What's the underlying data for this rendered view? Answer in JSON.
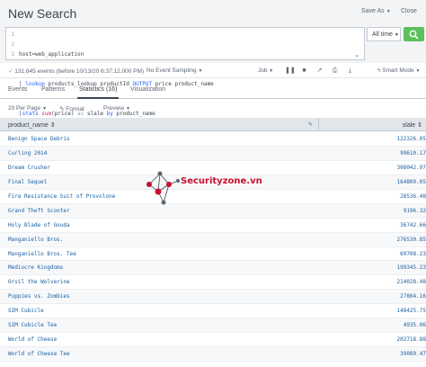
{
  "header": {
    "title": "New Search",
    "save_as": "Save As",
    "close": "Close"
  },
  "search": {
    "line_numbers": [
      "1",
      "2",
      "3"
    ],
    "line1": "host=web_application",
    "line2_pipe": "| ",
    "line2_cmd": "lookup",
    "line2_rest": " products_lookup productId ",
    "line2_kw": "OUTPUT",
    "line2_tail": " price product_name",
    "line3_pipe": "|",
    "line3_cmd": "stats",
    "line3_fn": " sum",
    "line3_arg": "(price)",
    "line3_as": " as",
    "line3_tail": " slale ",
    "line3_by": "by",
    "line3_end": " product_name",
    "time_range": "All time",
    "search_icon": "magnifier-icon"
  },
  "status": {
    "check": "✓",
    "events_text": "131,645 events (before 10/13/20 6:37:12.000 PM)",
    "sampling": "No Event Sampling",
    "job": "Job",
    "mode": "Smart Mode",
    "icons": [
      "pause-icon",
      "stop-icon",
      "share-icon",
      "print-icon",
      "export-icon"
    ]
  },
  "tabs": [
    {
      "label": "Events"
    },
    {
      "label": "Patterns"
    },
    {
      "label": "Statistics (16)",
      "active": true
    },
    {
      "label": "Visualization"
    }
  ],
  "table_controls": {
    "per_page": "20 Per Page",
    "format": "Format",
    "preview": "Preview"
  },
  "table": {
    "columns": [
      "product_name",
      "slale"
    ],
    "rows": [
      {
        "name": "Benign Space Debris",
        "sale": "122326.05"
      },
      {
        "name": "Curling 2014",
        "sale": "99610.17"
      },
      {
        "name": "Dream Crusher",
        "sale": "308042.97"
      },
      {
        "name": "Final Sequel",
        "sale": "164809.05"
      },
      {
        "name": "Fire Resistance Suit of Provolone",
        "sale": "28536.48"
      },
      {
        "name": "Grand Theft Scooter",
        "sale": "9196.32"
      },
      {
        "name": "Holy Blade of Gouda",
        "sale": "36742.66"
      },
      {
        "name": "Manganiello Bros.",
        "sale": "276530.85"
      },
      {
        "name": "Manganiello Bros. Tee",
        "sale": "69708.23"
      },
      {
        "name": "Mediocre Kingdoms",
        "sale": "199345.23"
      },
      {
        "name": "Orvil the Wolverine",
        "sale": "214028.48"
      },
      {
        "name": "Puppies vs. Zombies",
        "sale": "27864.16"
      },
      {
        "name": "SIM Cubicle",
        "sale": "148425.75"
      },
      {
        "name": "SIM Cubicle Tee",
        "sale": "4935.06"
      },
      {
        "name": "World of Cheese",
        "sale": "202718.88"
      },
      {
        "name": "World of Cheese Tee",
        "sale": "39089.47"
      }
    ]
  },
  "watermark": {
    "text": "Securityzone.vn"
  },
  "colors": {
    "accent_green": "#5cc05c",
    "link_blue": "#1a60a3",
    "header_bg": "#f2f4f5",
    "watermark_red": "#c8102e"
  }
}
